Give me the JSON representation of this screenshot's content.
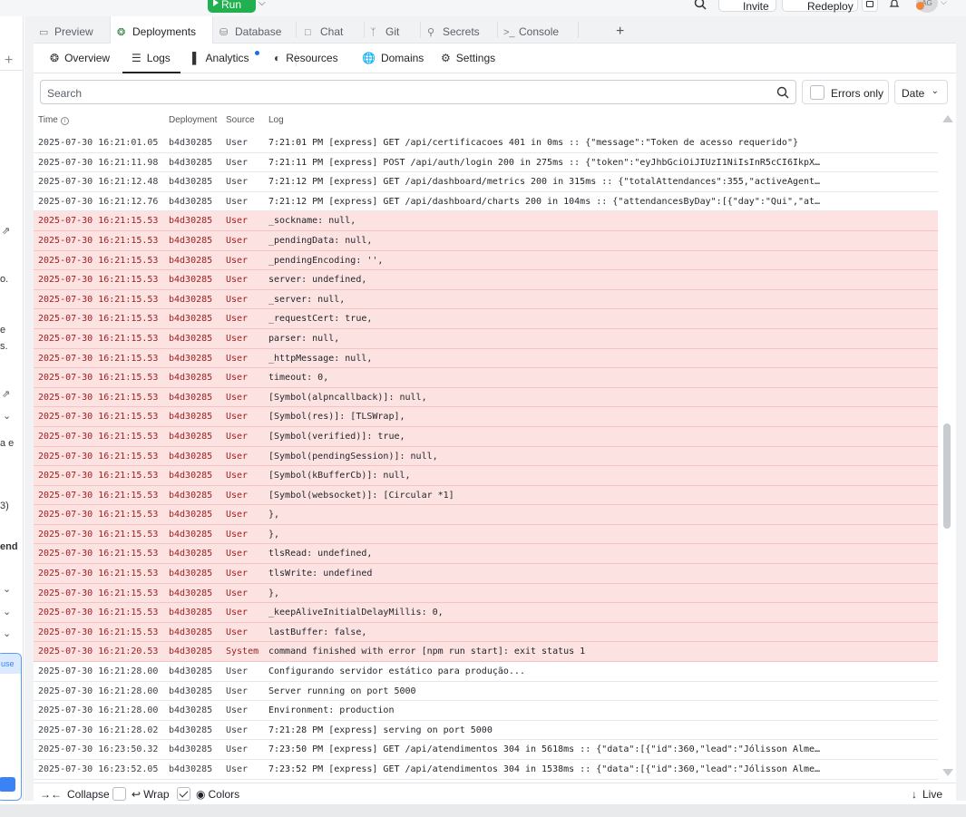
{
  "topbar": {
    "run_label": "Run",
    "invite_label": "Invite",
    "redeploy_label": "Redeploy",
    "avatar_initials": "AG"
  },
  "left_panel_fragments": [
    "o.",
    "e",
    "s.",
    "a e",
    "3)",
    "end"
  ],
  "left_panel_card_label": "use",
  "tabs": [
    {
      "label": "Preview",
      "icon": "monitor-icon"
    },
    {
      "label": "Deployments",
      "icon": "deploy-icon",
      "active": true
    },
    {
      "label": "Database",
      "icon": "database-icon"
    },
    {
      "label": "Chat",
      "icon": "chat-icon"
    },
    {
      "label": "Git",
      "icon": "git-icon"
    },
    {
      "label": "Secrets",
      "icon": "lock-icon"
    },
    {
      "label": "Console",
      "icon": "terminal-icon"
    }
  ],
  "subnav": [
    {
      "label": "Overview",
      "icon": "deploy-icon"
    },
    {
      "label": "Logs",
      "icon": "list-icon",
      "active": true
    },
    {
      "label": "Analytics",
      "icon": "bar-chart-icon",
      "notification": true
    },
    {
      "label": "Resources",
      "icon": "gauge-icon"
    },
    {
      "label": "Domains",
      "icon": "globe-icon"
    },
    {
      "label": "Settings",
      "icon": "gear-icon"
    }
  ],
  "filters": {
    "search_placeholder": "Search",
    "errors_only_label": "Errors only",
    "errors_only_checked": false,
    "date_label": "Date"
  },
  "log_columns": {
    "time": "Time",
    "deployment": "Deployment",
    "source": "Source",
    "log": "Log"
  },
  "log_rows": [
    {
      "time": "2025-07-30 16:21:01.05",
      "deployment": "b4d30285",
      "source": "User",
      "log": "7:21:01 PM [express] GET /api/certificacoes 401 in 0ms :: {\"message\":\"Token de acesso requerido\"}",
      "error": false
    },
    {
      "time": "2025-07-30 16:21:11.98",
      "deployment": "b4d30285",
      "source": "User",
      "log": "7:21:11 PM [express] POST /api/auth/login 200 in 275ms :: {\"token\":\"eyJhbGciOiJIUzI1NiIsInR5cCI6IkpX…",
      "error": false
    },
    {
      "time": "2025-07-30 16:21:12.48",
      "deployment": "b4d30285",
      "source": "User",
      "log": "7:21:12 PM [express] GET /api/dashboard/metrics 200 in 315ms :: {\"totalAttendances\":355,\"activeAgent…",
      "error": false
    },
    {
      "time": "2025-07-30 16:21:12.76",
      "deployment": "b4d30285",
      "source": "User",
      "log": "7:21:12 PM [express] GET /api/dashboard/charts 200 in 104ms :: {\"attendancesByDay\":[{\"day\":\"Qui\",\"at…",
      "error": false
    },
    {
      "time": "2025-07-30 16:21:15.53",
      "deployment": "b4d30285",
      "source": "User",
      "log": "_sockname: null,",
      "error": true
    },
    {
      "time": "2025-07-30 16:21:15.53",
      "deployment": "b4d30285",
      "source": "User",
      "log": "_pendingData: null,",
      "error": true
    },
    {
      "time": "2025-07-30 16:21:15.53",
      "deployment": "b4d30285",
      "source": "User",
      "log": "_pendingEncoding: '',",
      "error": true
    },
    {
      "time": "2025-07-30 16:21:15.53",
      "deployment": "b4d30285",
      "source": "User",
      "log": "server: undefined,",
      "error": true
    },
    {
      "time": "2025-07-30 16:21:15.53",
      "deployment": "b4d30285",
      "source": "User",
      "log": "_server: null,",
      "error": true
    },
    {
      "time": "2025-07-30 16:21:15.53",
      "deployment": "b4d30285",
      "source": "User",
      "log": "_requestCert: true,",
      "error": true
    },
    {
      "time": "2025-07-30 16:21:15.53",
      "deployment": "b4d30285",
      "source": "User",
      "log": "parser: null,",
      "error": true
    },
    {
      "time": "2025-07-30 16:21:15.53",
      "deployment": "b4d30285",
      "source": "User",
      "log": "_httpMessage: null,",
      "error": true
    },
    {
      "time": "2025-07-30 16:21:15.53",
      "deployment": "b4d30285",
      "source": "User",
      "log": "timeout: 0,",
      "error": true
    },
    {
      "time": "2025-07-30 16:21:15.53",
      "deployment": "b4d30285",
      "source": "User",
      "log": "[Symbol(alpncallback)]: null,",
      "error": true
    },
    {
      "time": "2025-07-30 16:21:15.53",
      "deployment": "b4d30285",
      "source": "User",
      "log": "[Symbol(res)]: [TLSWrap],",
      "error": true
    },
    {
      "time": "2025-07-30 16:21:15.53",
      "deployment": "b4d30285",
      "source": "User",
      "log": "[Symbol(verified)]: true,",
      "error": true
    },
    {
      "time": "2025-07-30 16:21:15.53",
      "deployment": "b4d30285",
      "source": "User",
      "log": "[Symbol(pendingSession)]: null,",
      "error": true
    },
    {
      "time": "2025-07-30 16:21:15.53",
      "deployment": "b4d30285",
      "source": "User",
      "log": "[Symbol(kBufferCb)]: null,",
      "error": true
    },
    {
      "time": "2025-07-30 16:21:15.53",
      "deployment": "b4d30285",
      "source": "User",
      "log": "[Symbol(websocket)]: [Circular *1]",
      "error": true
    },
    {
      "time": "2025-07-30 16:21:15.53",
      "deployment": "b4d30285",
      "source": "User",
      "log": "},",
      "error": true
    },
    {
      "time": "2025-07-30 16:21:15.53",
      "deployment": "b4d30285",
      "source": "User",
      "log": "},",
      "error": true
    },
    {
      "time": "2025-07-30 16:21:15.53",
      "deployment": "b4d30285",
      "source": "User",
      "log": "tlsRead: undefined,",
      "error": true
    },
    {
      "time": "2025-07-30 16:21:15.53",
      "deployment": "b4d30285",
      "source": "User",
      "log": "tlsWrite: undefined",
      "error": true
    },
    {
      "time": "2025-07-30 16:21:15.53",
      "deployment": "b4d30285",
      "source": "User",
      "log": "},",
      "error": true
    },
    {
      "time": "2025-07-30 16:21:15.53",
      "deployment": "b4d30285",
      "source": "User",
      "log": "_keepAliveInitialDelayMillis: 0,",
      "error": true
    },
    {
      "time": "2025-07-30 16:21:15.53",
      "deployment": "b4d30285",
      "source": "User",
      "log": "lastBuffer: false,",
      "error": true
    },
    {
      "time": "2025-07-30 16:21:20.53",
      "deployment": "b4d30285",
      "source": "System",
      "log": "command finished with error [npm run start]: exit status 1",
      "error": true
    },
    {
      "time": "2025-07-30 16:21:28.00",
      "deployment": "b4d30285",
      "source": "User",
      "log": "Configurando servidor estático para produção...",
      "error": false
    },
    {
      "time": "2025-07-30 16:21:28.00",
      "deployment": "b4d30285",
      "source": "User",
      "log": "Server running on port 5000",
      "error": false
    },
    {
      "time": "2025-07-30 16:21:28.00",
      "deployment": "b4d30285",
      "source": "User",
      "log": "Environment: production",
      "error": false
    },
    {
      "time": "2025-07-30 16:21:28.02",
      "deployment": "b4d30285",
      "source": "User",
      "log": "7:21:28 PM [express] serving on port 5000",
      "error": false
    },
    {
      "time": "2025-07-30 16:23:50.32",
      "deployment": "b4d30285",
      "source": "User",
      "log": "7:23:50 PM [express] GET /api/atendimentos 304 in 5618ms :: {\"data\":[{\"id\":360,\"lead\":\"Jólisson Alme…",
      "error": false
    },
    {
      "time": "2025-07-30 16:23:52.05",
      "deployment": "b4d30285",
      "source": "User",
      "log": "7:23:52 PM [express] GET /api/atendimentos 304 in 1538ms :: {\"data\":[{\"id\":360,\"lead\":\"Jólisson Alme…",
      "error": false
    }
  ],
  "footer": {
    "collapse_label": "Collapse",
    "wrap_label": "Wrap",
    "wrap_checked": false,
    "colors_label": "Colors",
    "colors_checked": true,
    "live_label": "Live"
  },
  "colors": {
    "run_green": "#20b050",
    "error_row_bg": "#fde2e2",
    "error_text": "#a02020",
    "accent_blue": "#1d6fe0"
  }
}
